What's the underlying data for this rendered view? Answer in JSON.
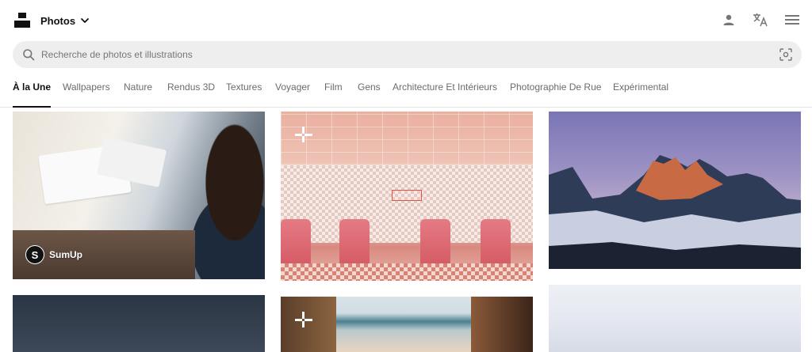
{
  "header": {
    "section_label": "Photos"
  },
  "search": {
    "placeholder": "Recherche de photos et illustrations"
  },
  "tabs": [
    {
      "label": "À la Une",
      "active": true
    },
    {
      "label": "Wallpapers"
    },
    {
      "label": "Nature"
    },
    {
      "label": "Rendus 3D"
    },
    {
      "label": "Textures"
    },
    {
      "label": "Voyager"
    },
    {
      "label": "Film"
    },
    {
      "label": "Gens"
    },
    {
      "label": "Architecture Et Intérieurs"
    },
    {
      "label": "Photographie De Rue"
    },
    {
      "label": "Expérimental"
    }
  ],
  "photos": [
    {
      "badge_name": "SumUp",
      "badge_initial": "S",
      "icon": "sponsor-avatar"
    },
    {
      "icon": "unsplash-plus-icon"
    },
    {},
    {},
    {
      "icon": "unsplash-plus-icon"
    },
    {}
  ],
  "colors": {
    "accent": "#111111",
    "muted_text": "#767676",
    "search_bg": "#eeeeee"
  }
}
